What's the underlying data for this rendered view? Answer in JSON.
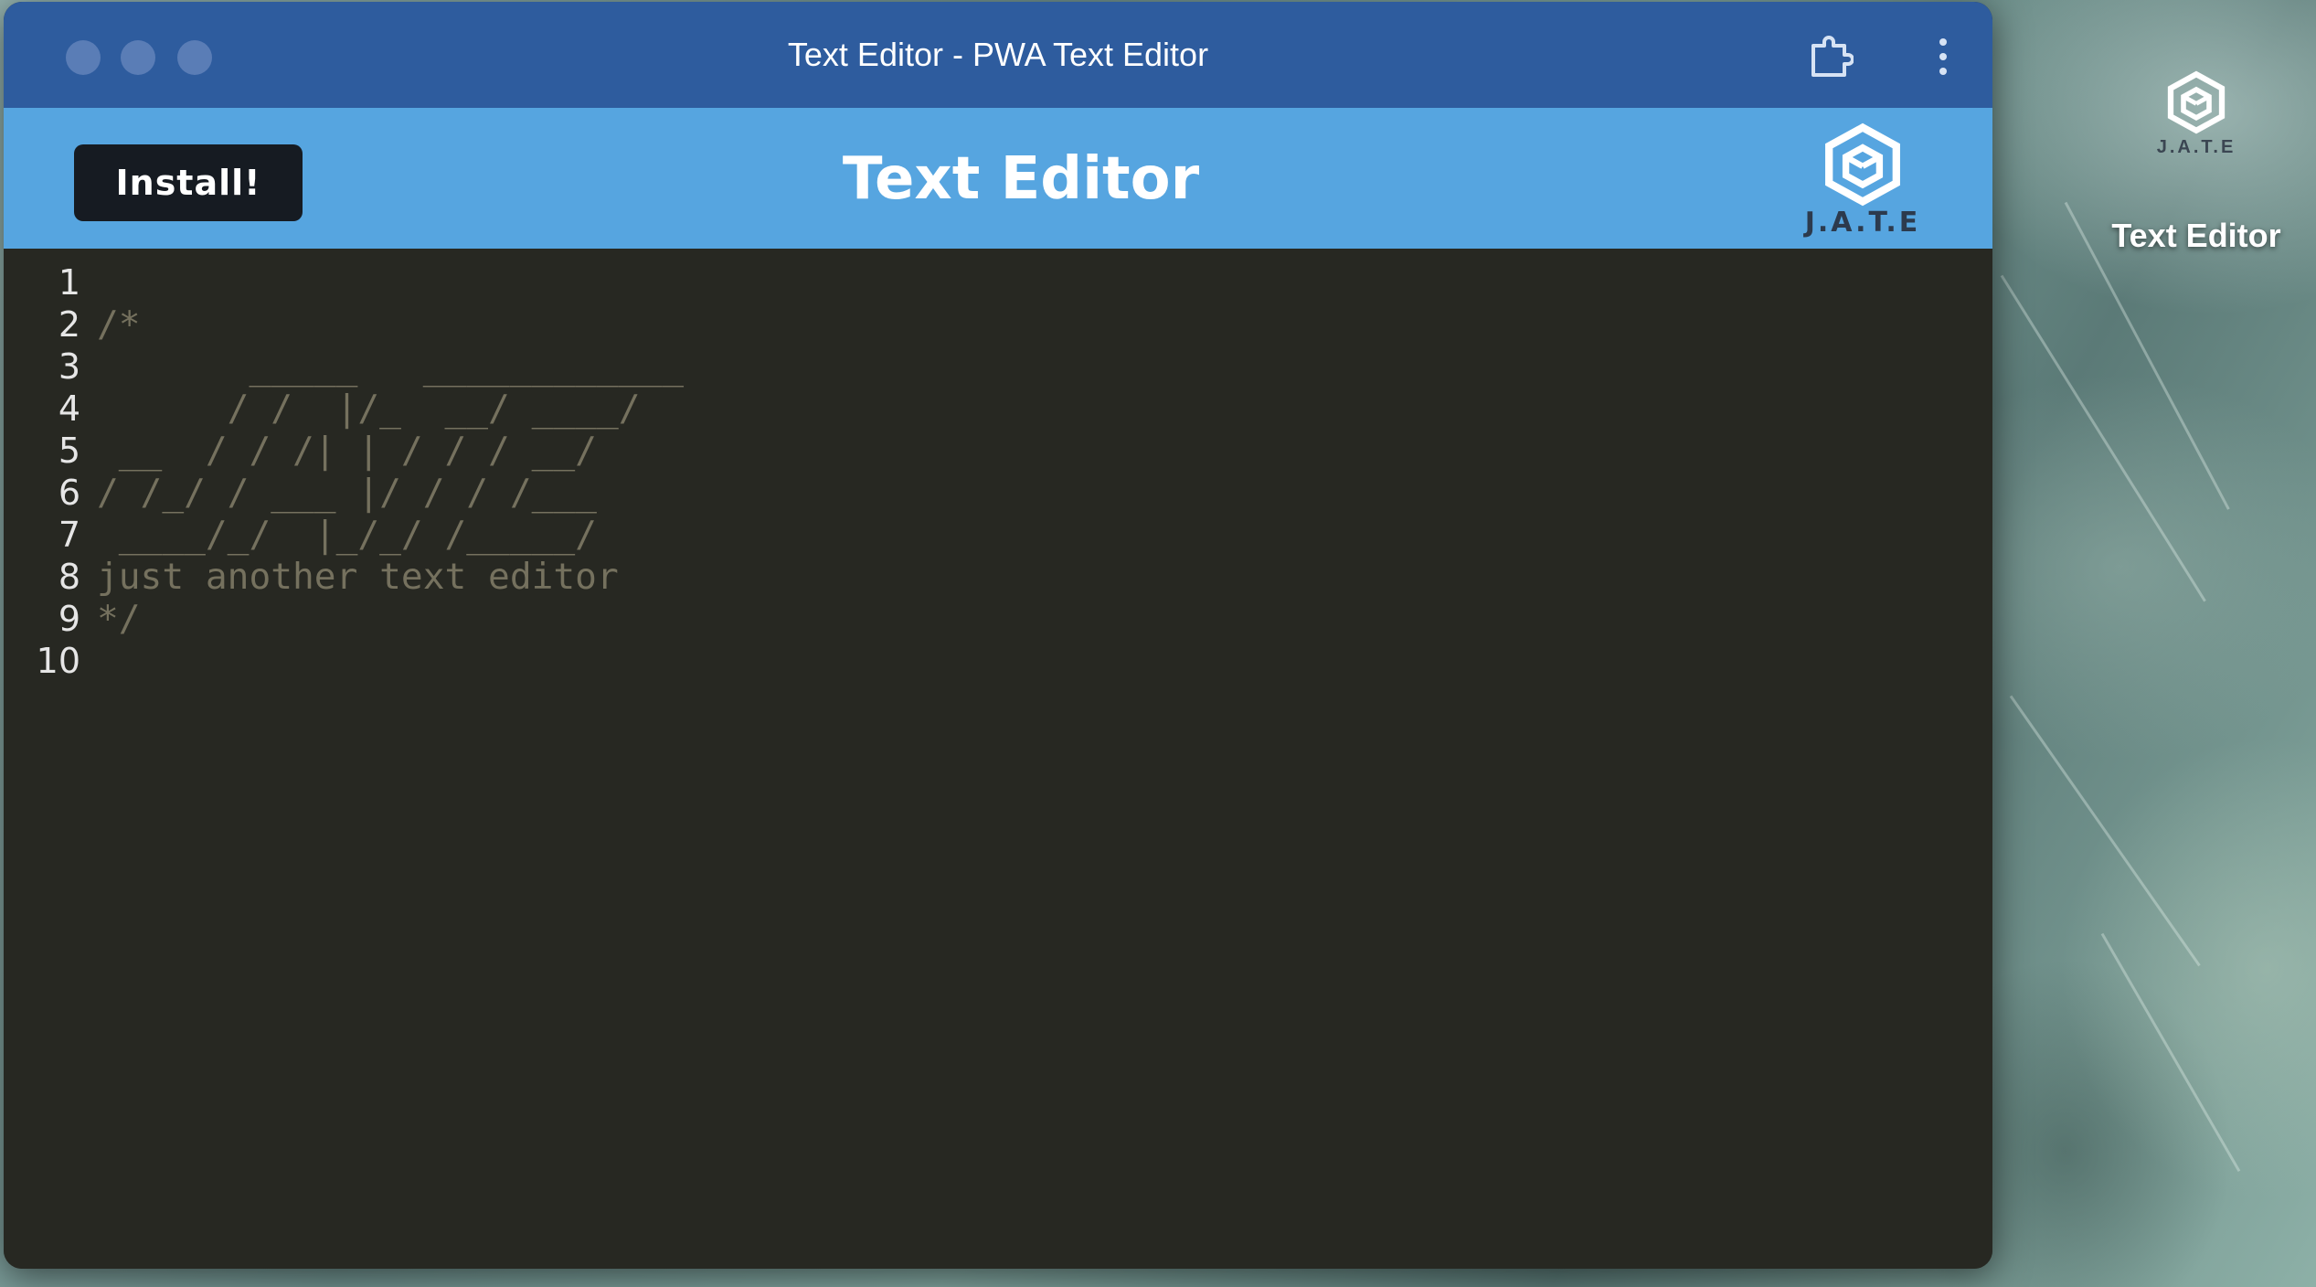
{
  "window": {
    "title": "Text Editor - PWA Text Editor"
  },
  "header": {
    "install_label": "Install!",
    "title": "Text Editor",
    "logo_text": "J.A.T.E"
  },
  "editor": {
    "line_numbers": [
      "1",
      "2",
      "3",
      "4",
      "5",
      "6",
      "7",
      "8",
      "9",
      "10"
    ],
    "lines": [
      "",
      "/*",
      "       _____   ____________",
      "      / /  |/_  __/ ____/",
      " __  / / /| | / / / __/",
      "/ /_/ / ___ |/ / / /___",
      " ____/_/  |_/_/ /_____/",
      "just another text editor",
      "*/",
      ""
    ],
    "comment_color": "#75715e",
    "background_color": "#272822"
  },
  "desktop": {
    "shortcut_brand": "J.A.T.E",
    "shortcut_label": "Text Editor"
  },
  "icons": {
    "extension": "puzzle-extension-icon",
    "menu": "vertical-ellipsis-icon",
    "logo": "hexagon-cube-logo"
  }
}
